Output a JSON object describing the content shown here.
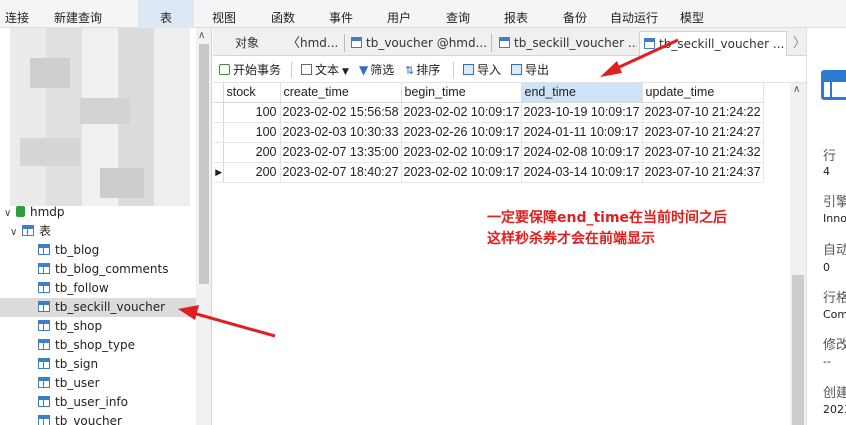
{
  "toolbar": {
    "items": [
      {
        "label": "连接",
        "icon": "connect-icon"
      },
      {
        "label": "新建查询",
        "icon": "new-query-icon"
      },
      {
        "label": "表",
        "icon": "table-icon"
      },
      {
        "label": "视图",
        "icon": "view-icon"
      },
      {
        "label": "函数",
        "icon": "function-icon"
      },
      {
        "label": "事件",
        "icon": "event-icon"
      },
      {
        "label": "用户",
        "icon": "user-icon"
      },
      {
        "label": "查询",
        "icon": "query-icon"
      },
      {
        "label": "报表",
        "icon": "report-icon"
      },
      {
        "label": "备份",
        "icon": "backup-icon"
      },
      {
        "label": "自动运行",
        "icon": "automation-icon"
      },
      {
        "label": "模型",
        "icon": "model-icon"
      }
    ]
  },
  "sidebar": {
    "database": "hmdp",
    "tables_group": "表",
    "tables": [
      "tb_blog",
      "tb_blog_comments",
      "tb_follow",
      "tb_seckill_voucher",
      "tb_shop",
      "tb_shop_type",
      "tb_sign",
      "tb_user",
      "tb_user_info",
      "tb_voucher"
    ],
    "selected_table": "tb_seckill_voucher"
  },
  "tabs": [
    {
      "label": "对象"
    },
    {
      "label": "hmd..."
    },
    {
      "label": "tb_voucher @hmd..."
    },
    {
      "label": "tb_seckill_voucher ..."
    },
    {
      "label": "tb_seckill_voucher ..."
    }
  ],
  "actions": {
    "begin_transaction": "开始事务",
    "text": "文本",
    "filter": "筛选",
    "sort": "排序",
    "import": "导入",
    "export": "导出"
  },
  "grid": {
    "columns": [
      "stock",
      "create_time",
      "begin_time",
      "end_time",
      "update_time"
    ],
    "selected_column": "end_time",
    "rows": [
      [
        "100",
        "2023-02-02 15:56:58",
        "2023-02-02 10:09:17",
        "2023-10-19 10:09:17",
        "2023-07-10 21:24:22"
      ],
      [
        "100",
        "2023-02-03 10:30:33",
        "2023-02-26 10:09:17",
        "2024-01-11 10:09:17",
        "2023-07-10 21:24:27"
      ],
      [
        "200",
        "2023-02-07 13:35:00",
        "2023-02-02 10:09:17",
        "2024-02-08 10:09:17",
        "2023-07-10 21:24:32"
      ],
      [
        "200",
        "2023-02-07 18:40:27",
        "2023-02-02 10:09:17",
        "2024-03-14 10:09:17",
        "2023-07-10 21:24:37"
      ]
    ]
  },
  "info_panel": {
    "rows_label": "行",
    "rows_value": "4",
    "engine_label": "引擎",
    "engine_value": "Inno",
    "auto_inc_label": "自动",
    "auto_inc_value": "0",
    "row_format_label": "行格",
    "row_format_value": "Com",
    "modified_label": "修改",
    "modified_value": "--",
    "created_label": "创建",
    "created_value": "2023"
  },
  "annotation": {
    "line1": "一定要保障end_time在当前时间之后",
    "line2": "这样秒杀券才会在前端显示",
    "color": "#e02020"
  }
}
